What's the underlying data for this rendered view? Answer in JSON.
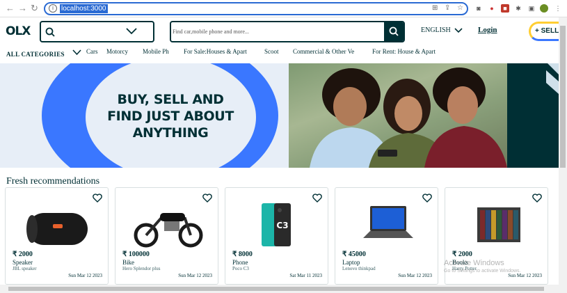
{
  "browser": {
    "url": "localhost:3000"
  },
  "header": {
    "logo": "OLX",
    "search_placeholder": "Find car,mobile phone and more...",
    "language": "ENGLISH",
    "login": "Login",
    "sell": "+ SELL"
  },
  "categories": {
    "all": "ALL CATEGORIES",
    "items": [
      "Cars",
      "Motorcy",
      "Mobile Ph",
      "For Sale:Houses & Apart",
      "Scoot",
      "Commercial & Other Ve",
      "For Rent: House & Apart"
    ]
  },
  "banner": {
    "line1": "BUY, SELL AND",
    "line2": "FIND JUST ABOUT",
    "line3": "ANYTHING"
  },
  "section_title": "Fresh recommendations",
  "products": [
    {
      "price": "₹ 2000",
      "category": "Speaker",
      "name": "JBL speaker",
      "date": "Sun Mar 12 2023"
    },
    {
      "price": "₹ 100000",
      "category": "Bike",
      "name": "Hero Splendor plus",
      "date": "Sun Mar 12 2023"
    },
    {
      "price": "₹ 8000",
      "category": "Phone",
      "name": "Poco C3",
      "date": "Sat Mar 11 2023"
    },
    {
      "price": "₹ 45000",
      "category": "Laptop",
      "name": "Lenovo thinkpad",
      "date": "Sun Mar 12 2023"
    },
    {
      "price": "₹ 2000",
      "category": "Books",
      "name": "Harry Potter",
      "date": "Sun Mar 12 2023"
    }
  ],
  "os_watermark": {
    "title": "Activate Windows",
    "subtitle": "Go to Settings to activate Windows."
  },
  "colors": {
    "brand_dark": "#002f34",
    "accent_blue": "#3a77ff",
    "banner_bg": "#e7eef7",
    "sell_yellow": "#ffce32",
    "sell_teal": "#23e5db"
  }
}
